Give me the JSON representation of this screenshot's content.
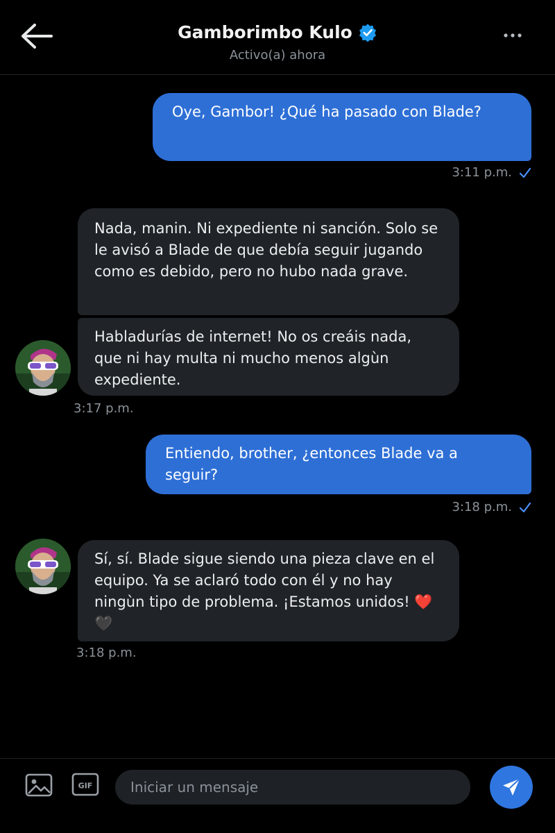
{
  "header": {
    "title": "Gamborimbo Kulo",
    "subtitle": "Activo(a) ahora",
    "icons": {
      "back": "back-arrow-icon",
      "verified": "verified-badge-icon",
      "more": "more-options-icon"
    }
  },
  "messages": [
    {
      "from": "me",
      "text": "Oye, Gambor! ¿Qué ha pasado con Blade?",
      "time": "3:11 p.m.",
      "status": "check-icon"
    },
    {
      "from": "them",
      "text": "Nada, manin. Ni expediente ni sanción. Solo se le avisó a Blade de que debía seguir jugando como es debido, pero no hubo nada grave."
    },
    {
      "from": "them",
      "text": "Habladurías de internet! No os creáis nada, que ni hay multa ni mucho menos algùn expediente.",
      "time": "3:17 p.m."
    },
    {
      "from": "me",
      "text": "Entiendo, brother, ¿entonces Blade va a seguir?",
      "time": "3:18 p.m.",
      "status": "check-icon"
    },
    {
      "from": "them",
      "text": "Sí, sí. Blade sigue siendo una pieza clave en el equipo. Ya se aclaró todo con él y no hay ningùn tipo de problema. ¡Estamos unidos! ❤️🖤",
      "time": "3:18 p.m."
    }
  ],
  "composer": {
    "placeholder": "Iniciar un mensaje",
    "gif_label": "GIF",
    "icons": {
      "image": "image-icon",
      "gif": "gif-icon",
      "send": "send-icon"
    }
  },
  "colors": {
    "background": "#000000",
    "sent_bubble": "#2e6fd6",
    "received_bubble": "#202327",
    "accent": "#1d9bf0"
  }
}
